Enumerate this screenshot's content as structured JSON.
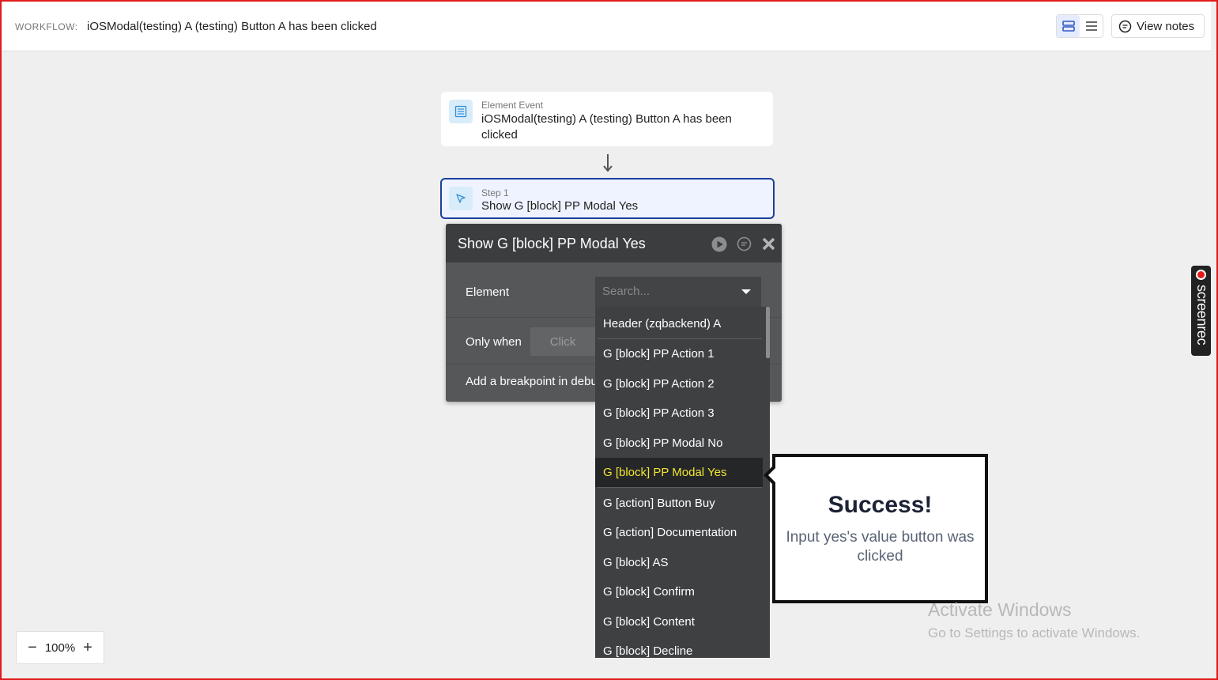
{
  "topbar": {
    "workflow_label": "WORKFLOW:",
    "workflow_title": "iOSModal(testing) A (testing) Button A has been clicked",
    "view_notes_label": "View notes"
  },
  "event_card": {
    "kicker": "Element Event",
    "title": "iOSModal(testing) A (testing) Button A has been clicked"
  },
  "step_card": {
    "kicker": "Step 1",
    "title": "Show G [block] PP Modal Yes"
  },
  "editor": {
    "title": "Show G [block] PP Modal Yes",
    "element_label": "Element",
    "only_when_label": "Only when",
    "click_placeholder": "Click",
    "breakpoint_label": "Add a breakpoint in debug mode"
  },
  "dropdown": {
    "search_placeholder": "Search...",
    "items": [
      "Header (zqbackend) A",
      "G [block] PP Action 1",
      "G [block] PP Action 2",
      "G [block] PP Action 3",
      "G [block] PP Modal No",
      "G [block] PP Modal Yes",
      "G [action] Button Buy",
      "G [action] Documentation",
      "G [block] AS",
      "G [block] Confirm",
      "G [block] Content",
      "G [block] Decline"
    ],
    "selected_index": 5,
    "selected_color": "#f2e533"
  },
  "popup": {
    "title": "Success!",
    "body": "Input yes's value button was clicked"
  },
  "watermark": {
    "title": "Activate Windows",
    "subtitle": "Go to Settings to activate Windows."
  },
  "screenrec": {
    "label": "screenrec"
  },
  "zoom": {
    "minus": "−",
    "level": "100%",
    "plus": "+"
  },
  "colors": {
    "accent": "#1a3f9c",
    "editor_bg": "#555759",
    "frame_border": "#e01b1b"
  },
  "icons": {
    "event": "list-icon",
    "step": "cursor-icon",
    "run": "play-icon",
    "note": "note-icon",
    "close": "close-icon"
  }
}
